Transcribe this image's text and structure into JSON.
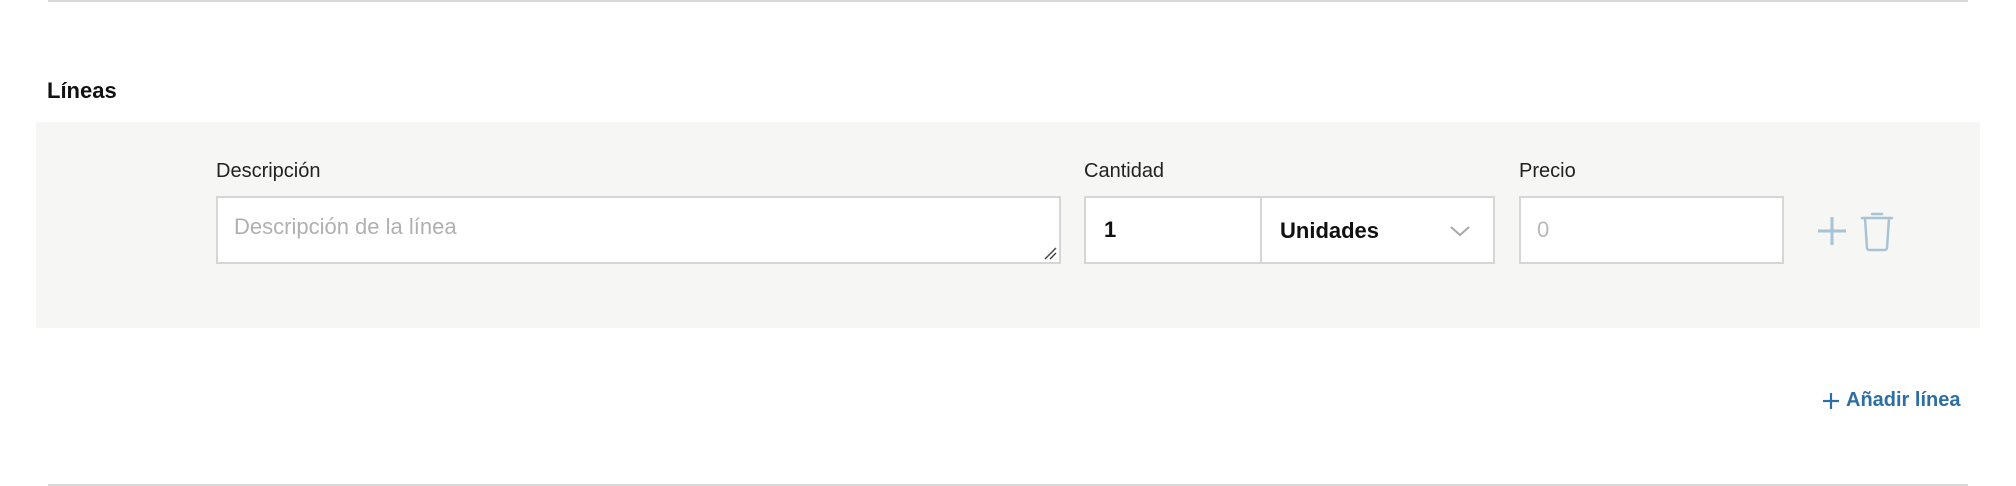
{
  "section": {
    "title": "Líneas"
  },
  "line": {
    "description": {
      "label": "Descripción",
      "placeholder": "Descripción de la línea",
      "value": ""
    },
    "quantity": {
      "label": "Cantidad",
      "value": "1"
    },
    "unit": {
      "selected": "Unidades"
    },
    "price": {
      "label": "Precio",
      "placeholder": "0",
      "value": ""
    }
  },
  "actions": {
    "add_line_label": "Añadir línea"
  },
  "icons": {
    "add": "plus-icon",
    "delete": "trash-icon",
    "dropdown": "chevron-down-icon",
    "add_line": "plus-icon",
    "resize": "resize-grip-icon"
  },
  "colors": {
    "accent": "#2e6fa3",
    "icon_muted": "#a9c3d6",
    "row_background": "#f6f6f4",
    "border": "#d6d6d6"
  }
}
